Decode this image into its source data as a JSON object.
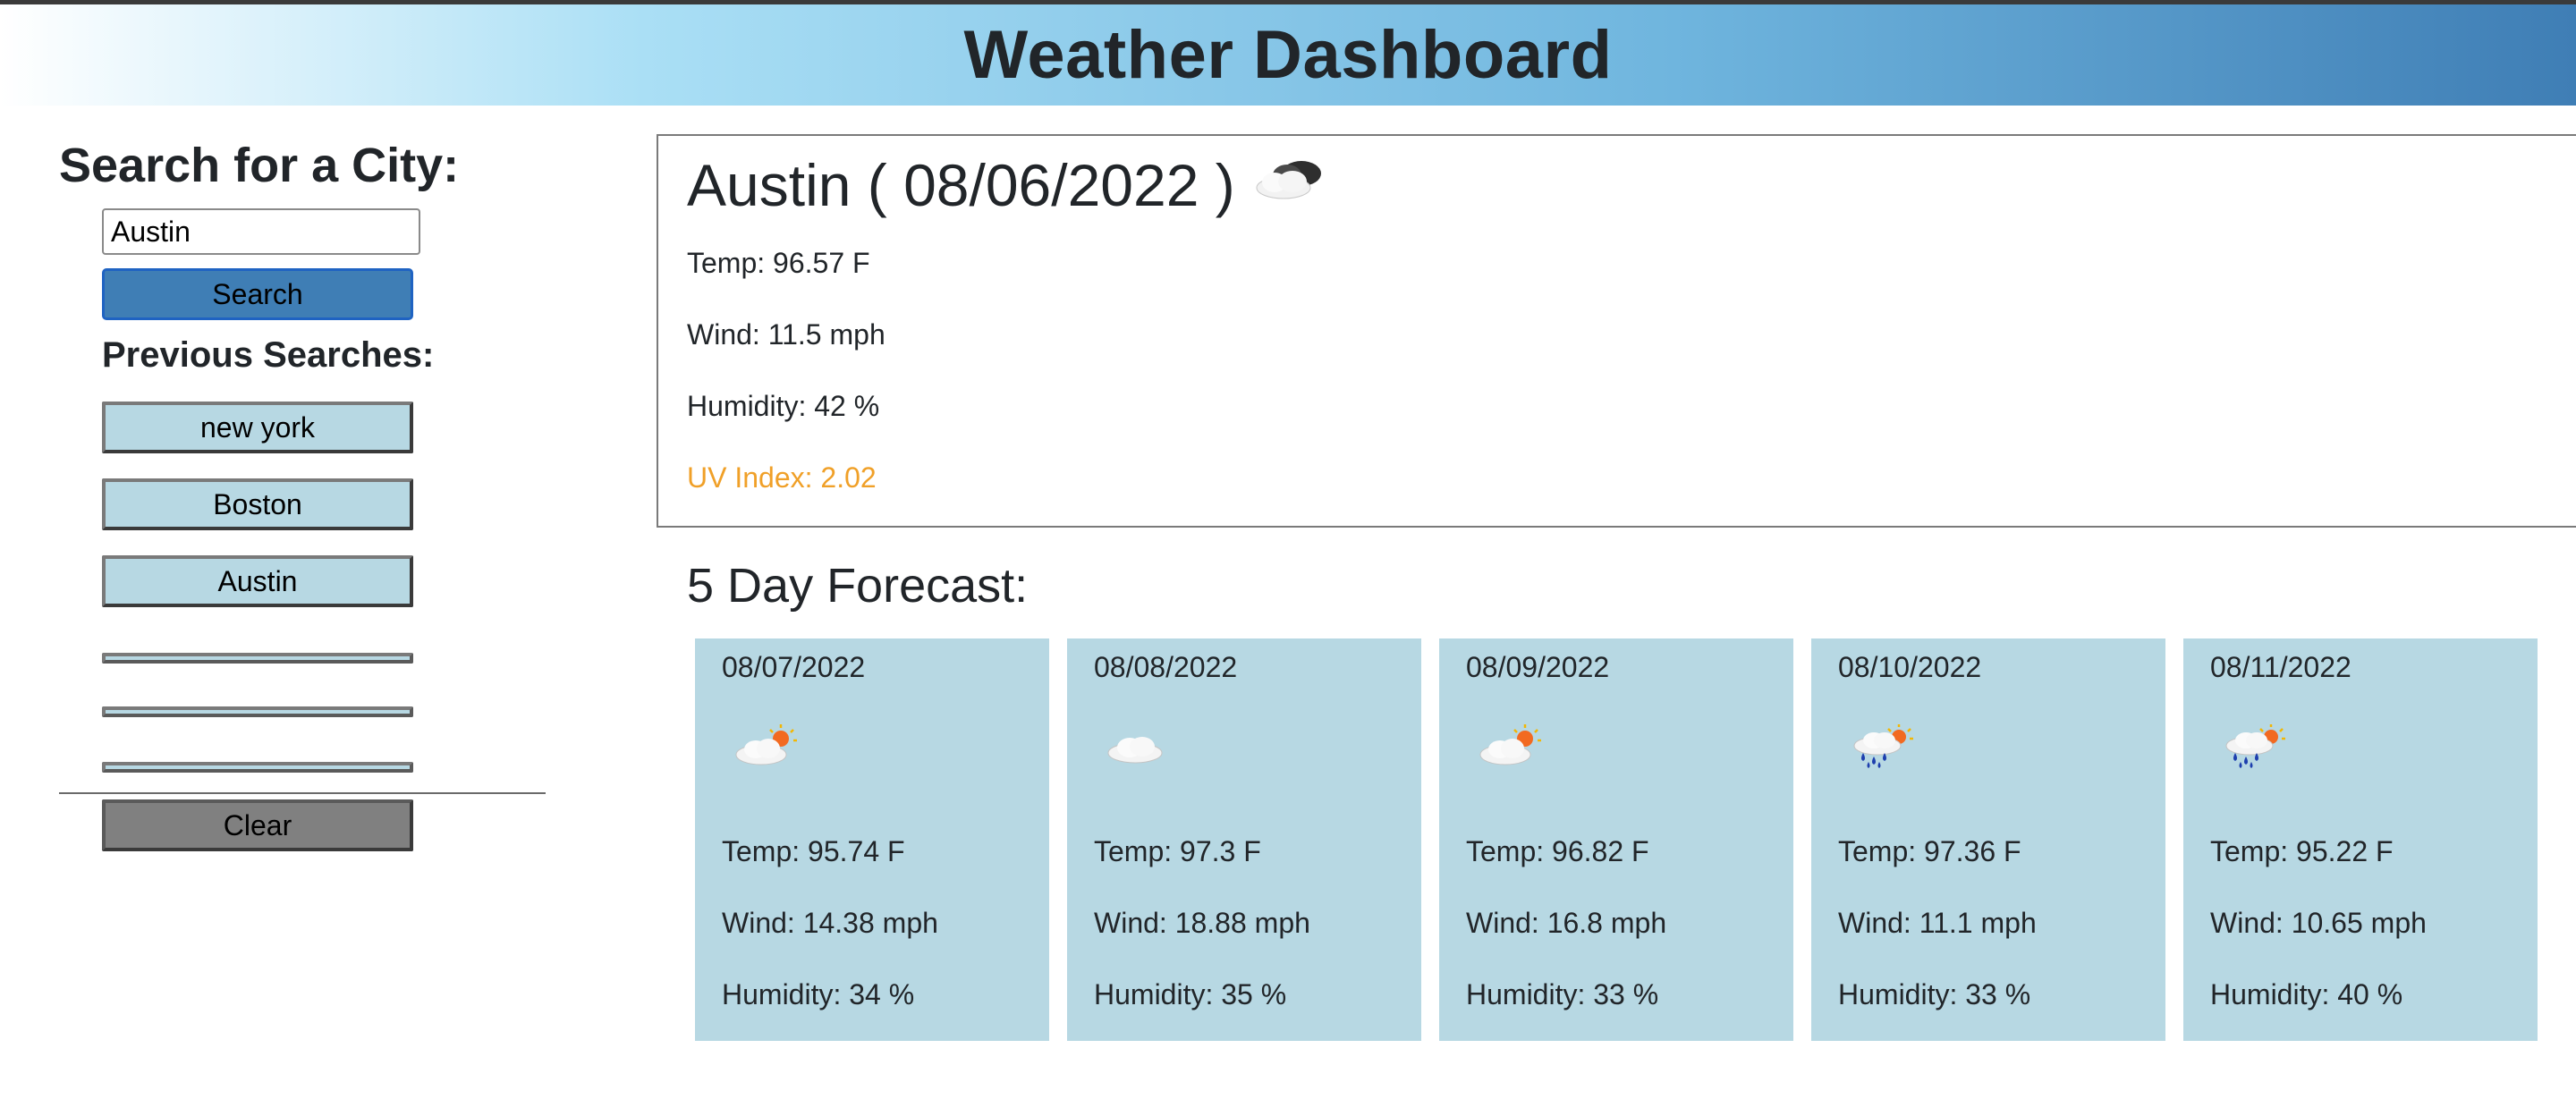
{
  "header": {
    "title": "Weather Dashboard"
  },
  "sidebar": {
    "search_title": "Search for a City:",
    "search_input_value": "Austin",
    "search_button": "Search",
    "previous_title": "Previous Searches:",
    "previous": [
      "new york",
      "Boston",
      "Austin"
    ],
    "clear_button": "Clear"
  },
  "current": {
    "title": "Austin ( 08/06/2022 )",
    "icon": "broken-clouds-icon",
    "temp": "Temp: 96.57 F",
    "wind": "Wind: 11.5 mph",
    "humidity": "Humidity: 42 %",
    "uv": "UV Index: 2.02",
    "uv_color": "#f0a028"
  },
  "forecast": {
    "title": "5 Day Forecast:",
    "card_color": "#b7d8e3",
    "days": [
      {
        "date": "08/07/2022",
        "icon": "partly-cloudy-icon",
        "temp": "Temp: 95.74 F",
        "wind": "Wind: 14.38 mph",
        "humidity": "Humidity: 34 %"
      },
      {
        "date": "08/08/2022",
        "icon": "cloud-icon",
        "temp": "Temp: 97.3 F",
        "wind": "Wind: 18.88 mph",
        "humidity": "Humidity: 35 %"
      },
      {
        "date": "08/09/2022",
        "icon": "partly-cloudy-icon",
        "temp": "Temp: 96.82 F",
        "wind": "Wind: 16.8 mph",
        "humidity": "Humidity: 33 %"
      },
      {
        "date": "08/10/2022",
        "icon": "rain-sun-icon",
        "temp": "Temp: 97.36 F",
        "wind": "Wind: 11.1 mph",
        "humidity": "Humidity: 33 %"
      },
      {
        "date": "08/11/2022",
        "icon": "rain-sun-icon",
        "temp": "Temp: 95.22 F",
        "wind": "Wind: 10.65 mph",
        "humidity": "Humidity: 40 %"
      }
    ]
  }
}
